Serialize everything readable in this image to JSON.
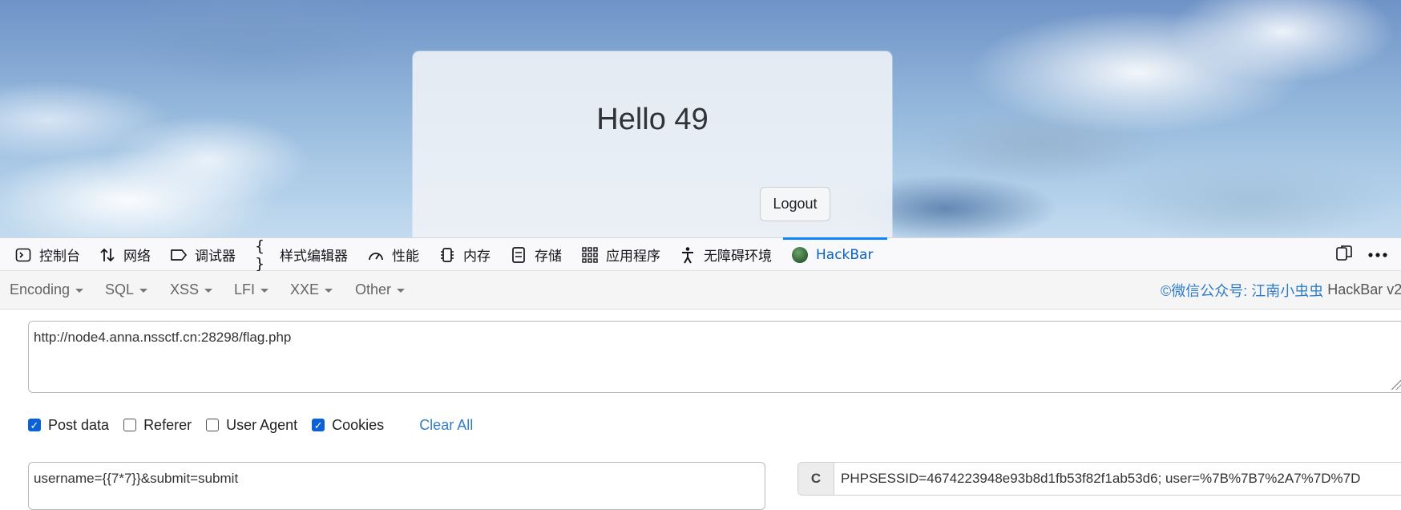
{
  "page": {
    "heading": "Hello 49",
    "logout_label": "Logout"
  },
  "devtools": {
    "tabs": [
      {
        "label": "控制台",
        "icon": "console-icon"
      },
      {
        "label": "网络",
        "icon": "network-arrows-icon"
      },
      {
        "label": "调试器",
        "icon": "debugger-tag-icon"
      },
      {
        "label": "样式编辑器",
        "icon": "braces-icon"
      },
      {
        "label": "性能",
        "icon": "gauge-icon"
      },
      {
        "label": "内存",
        "icon": "memory-chip-icon"
      },
      {
        "label": "存储",
        "icon": "storage-icon"
      },
      {
        "label": "应用程序",
        "icon": "grid-icon"
      },
      {
        "label": "无障碍环境",
        "icon": "accessibility-person-icon"
      },
      {
        "label": "HackBar",
        "icon": "hackbar-ball-icon",
        "active": true
      }
    ],
    "right_icons": [
      "dock-toggle-icon",
      "more-options-icon"
    ]
  },
  "hackbar": {
    "menus": [
      "Encoding",
      "SQL",
      "XSS",
      "LFI",
      "XXE",
      "Other"
    ],
    "credit": {
      "link": "©微信公众号: 江南小虫虫",
      "version": "HackBar v2"
    },
    "url": "http://node4.anna.nssctf.cn:28298/flag.php",
    "options": [
      {
        "label": "Post data",
        "checked": true
      },
      {
        "label": "Referer",
        "checked": false
      },
      {
        "label": "User Agent",
        "checked": false
      },
      {
        "label": "Cookies",
        "checked": true
      }
    ],
    "clear_all": "Clear All",
    "post_data": "username={{7*7}}&submit=submit",
    "cookie_label": "C",
    "cookie_value": "PHPSESSID=4674223948e93b8d1fb53f82f1ab53d6; user=%7B%7B7%2A7%7D%7D"
  },
  "colors": {
    "accent": "#0a84ff",
    "link": "#2f7dc7",
    "checkbox": "#0b62d6"
  }
}
